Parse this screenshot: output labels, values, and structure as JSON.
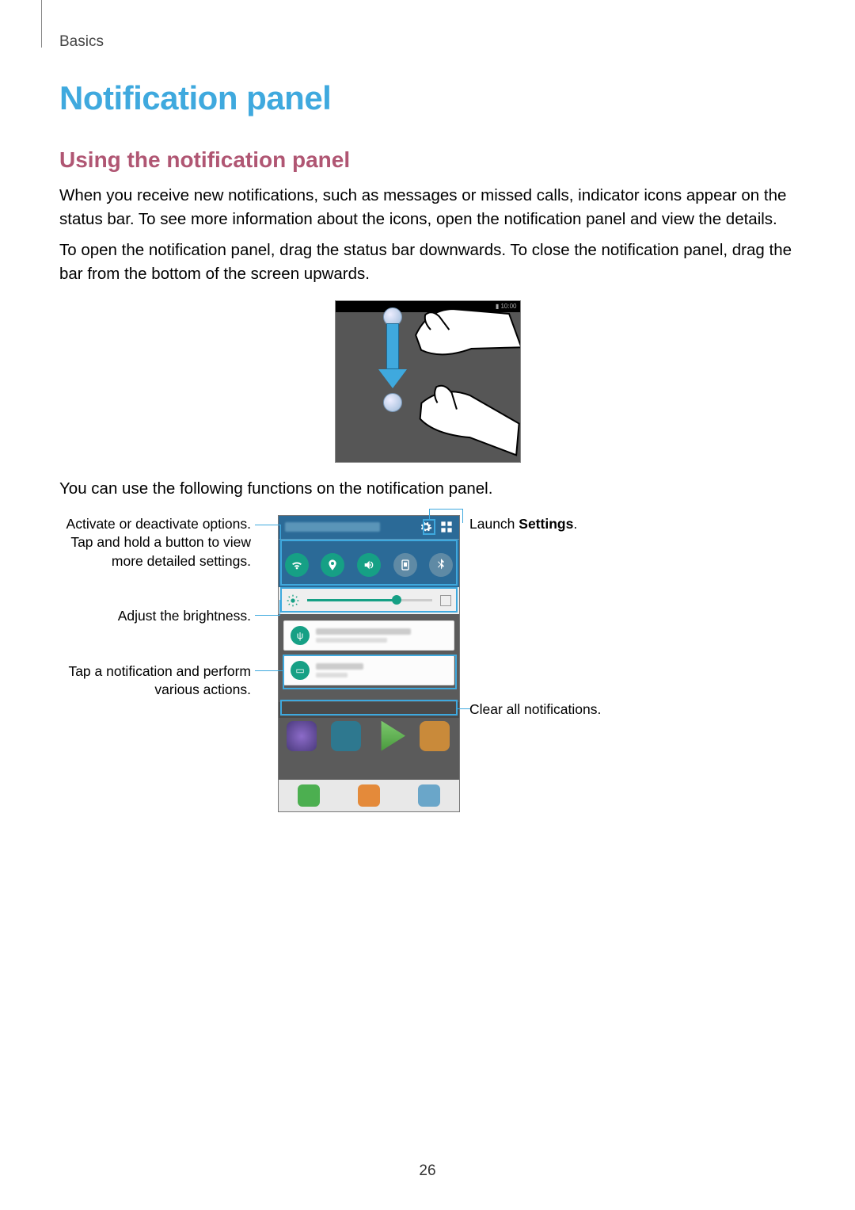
{
  "header": {
    "chapter": "Basics"
  },
  "title": "Notification panel",
  "subtitle": "Using the notification panel",
  "para1": "When you receive new notifications, such as messages or missed calls, indicator icons appear on the status bar. To see more information about the icons, open the notification panel and view the details.",
  "para2": "To open the notification panel, drag the status bar downwards. To close the notification panel, drag the bar from the bottom of the screen upwards.",
  "fig1": {
    "status_time": "10:00"
  },
  "para3": "You can use the following functions on the notification panel.",
  "callouts": {
    "toggles": "Activate or deactivate options. Tap and hold a button to view more detailed settings.",
    "settings_prefix": "Launch ",
    "settings_bold": "Settings",
    "settings_suffix": ".",
    "brightness": "Adjust the brightness.",
    "notif": "Tap a notification and perform various actions.",
    "clear": "Clear all notifications."
  },
  "page_number": "26"
}
